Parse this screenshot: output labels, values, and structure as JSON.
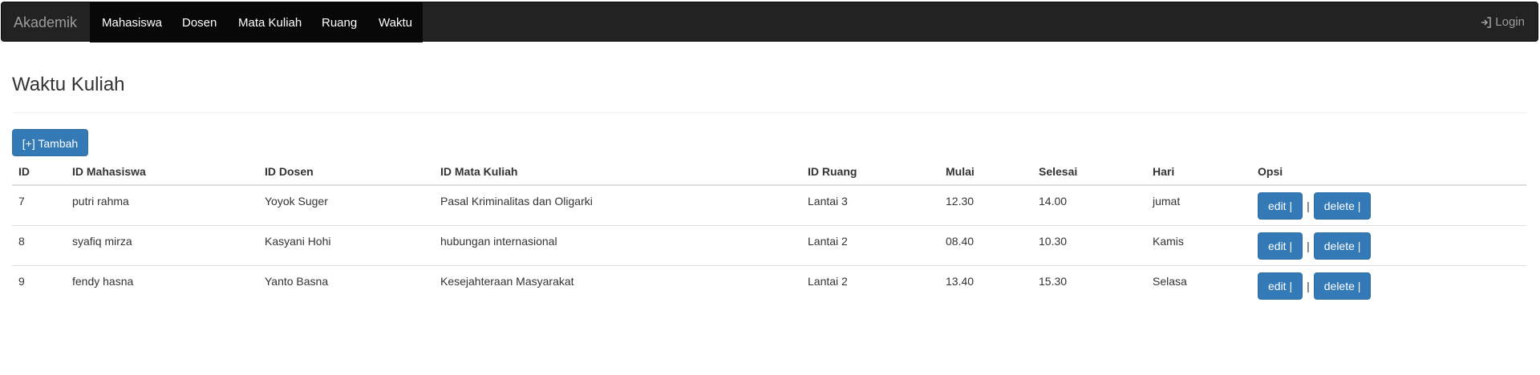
{
  "navbar": {
    "brand": "Akademik",
    "items": [
      "Mahasiswa",
      "Dosen",
      "Mata Kuliah",
      "Ruang",
      "Waktu"
    ],
    "login_label": "Login",
    "login_icon": "login-icon",
    "colors": {
      "bar": "#222222",
      "active_block": "#080808",
      "muted_text": "#9d9d9d"
    }
  },
  "page": {
    "title": "Waktu Kuliah",
    "add_button_label": "[+] Tambah",
    "primary_color": "#337ab7"
  },
  "table": {
    "columns": [
      "ID",
      "ID Mahasiswa",
      "ID Dosen",
      "ID Mata Kuliah",
      "ID Ruang",
      "Mulai",
      "Selesai",
      "Hari",
      "Opsi"
    ],
    "rows": [
      {
        "id": "7",
        "mahasiswa": "putri rahma",
        "dosen": "Yoyok Suger",
        "mata_kuliah": "Pasal Kriminalitas dan Oligarki",
        "ruang": "Lantai 3",
        "mulai": "12.30",
        "selesai": "14.00",
        "hari": "jumat"
      },
      {
        "id": "8",
        "mahasiswa": "syafiq mirza",
        "dosen": "Kasyani Hohi",
        "mata_kuliah": "hubungan internasional",
        "ruang": "Lantai 2",
        "mulai": "08.40",
        "selesai": "10.30",
        "hari": "Kamis"
      },
      {
        "id": "9",
        "mahasiswa": "fendy hasna",
        "dosen": "Yanto Basna",
        "mata_kuliah": "Kesejahteraan Masyarakat",
        "ruang": "Lantai 2",
        "mulai": "13.40",
        "selesai": "15.30",
        "hari": "Selasa"
      }
    ],
    "edit_label": "edit |",
    "separator": "|",
    "delete_label": "delete |"
  }
}
